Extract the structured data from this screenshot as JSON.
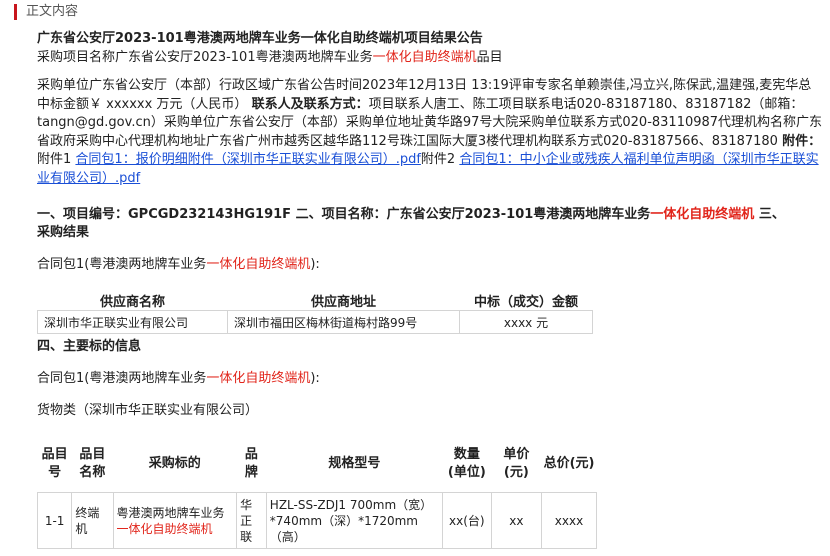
{
  "section_label": "正文内容",
  "title": "广东省公安厅2023-101粤港澳两地牌车业务一体化自助终端机项目结果公告",
  "project_line": {
    "prefix": "采购项目名称广东省公安厅2023-101粤港澳两地牌车业务",
    "highlight": "一体化自助终端机",
    "suffix": "品目"
  },
  "info": {
    "part1": "采购单位广东省公安厅（本部）行政区域广东省公告时间2023年12月13日 13:19评审专家名单赖崇佳,冯立兴,陈保武,温建强,麦宪华总中标金额￥ xxxxxx 万元（人民币）",
    "contact_label": "联系人及联系方式：",
    "part2": "项目联系人唐工、陈工项目联系电话020-83187180、83187182（邮箱：tangn@gd.gov.cn）采购单位广东省公安厅（本部）采购单位地址黄华路97号大院采购单位联系方式020-83110987代理机构名称广东省政府采购中心代理机构地址广东省广州市越秀区越华路112号珠江国际大厦3楼代理机构联系方式020-83187566、83187180",
    "attach_label": "附件：",
    "attach1_prefix": "附件1",
    "attach1_link": "合同包1：报价明细附件（深圳市华正联实业有限公司）.pdf",
    "attach2_prefix": "附件2",
    "attach2_link": "合同包1：中小企业或残疾人福利单位声明函（深圳市华正联实业有限公司）.pdf"
  },
  "heading1": {
    "prefix": "一、项目编号：GPCGD232143HG191F 二、项目名称：广东省公安厅2023-101粤港澳两地牌车业务",
    "highlight": "一体化自助终端机",
    "suffix": " 三、"
  },
  "heading1_line2": "采购结果",
  "contract_pkg": {
    "prefix": "合同包1(粤港澳两地牌车业务",
    "highlight": "一体化自助终端机",
    "suffix": "):"
  },
  "supplier_table": {
    "headers": [
      "供应商名称",
      "供应商地址",
      "中标（成交）金额"
    ],
    "row": [
      "深圳市华正联实业有限公司",
      "深圳市福田区梅林街道梅村路99号",
      "xxxx  元"
    ]
  },
  "heading2": "四、主要标的信息",
  "goods_label": "货物类（深圳市华正联实业有限公司）",
  "items_table": {
    "headers": [
      "品目号",
      "品目名称",
      "采购标的",
      "品牌",
      "规格型号",
      "数量(单位)",
      "单价(元)",
      "总价(元)"
    ],
    "row": {
      "no": "1-1",
      "name": "终端机",
      "subject_prefix": "粤港澳两地牌车业务",
      "subject_highlight": "一体化自助终端机",
      "brand": "华正联",
      "spec": "HZL-SS-ZDJ1 700mm（宽）*740mm（深）*1720mm（高）",
      "qty": "xx(台)",
      "unit_price": "xx",
      "total": "xxxx"
    }
  },
  "colors": {
    "accent_red": "#e1251b",
    "link_blue": "#1a4fd6",
    "section_bar": "#c8161d"
  }
}
